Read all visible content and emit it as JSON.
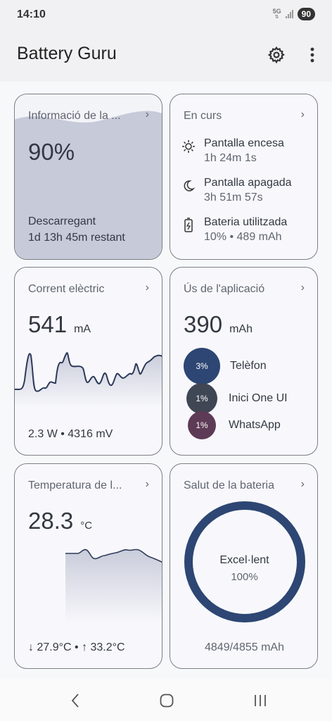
{
  "status": {
    "time": "14:10",
    "network": "5G",
    "battery": "90"
  },
  "app": {
    "title": "Battery Guru"
  },
  "cards": {
    "info": {
      "title": "Informació de la ...",
      "percent": "90%",
      "state": "Descarregant",
      "remaining": "1d 13h 45m restant",
      "level": 0.9
    },
    "ongoing": {
      "title": "En curs",
      "items": [
        {
          "icon": "sun-icon",
          "label": "Pantalla encesa",
          "value": "1h 24m 1s"
        },
        {
          "icon": "moon-icon",
          "label": "Pantalla apagada",
          "value": "3h 51m 57s"
        },
        {
          "icon": "battery-charging-icon",
          "label": "Bateria utilitzada",
          "value": "10% • 489 mAh"
        }
      ]
    },
    "current": {
      "title": "Corrent elèctric",
      "value": "541",
      "unit": "mA",
      "footer": "2.3 W • 4316 mV"
    },
    "app_usage": {
      "title": "Ús de l'aplicació",
      "value": "390",
      "unit": "mAh",
      "apps": [
        {
          "name": "Telèfon",
          "percent": "3%",
          "color": "#2d4673"
        },
        {
          "name": "Inici One UI",
          "percent": "1%",
          "color": "#3f4654"
        },
        {
          "name": "WhatsApp",
          "percent": "1%",
          "color": "#5d3a55"
        }
      ]
    },
    "temperature": {
      "title": "Temperatura de l...",
      "value": "28.3",
      "unit": "°C",
      "min": "↓ 27.9°C",
      "max": "↑ 33.2°C",
      "separator": "•"
    },
    "health": {
      "title": "Salut de la bateria",
      "status": "Excel·lent",
      "percent": "100%",
      "capacity": "4849/4855 mAh"
    }
  },
  "colors": {
    "accent": "#2d4673",
    "card_fill": "#c6cad9",
    "chart_fill": "#dfe1ea"
  }
}
